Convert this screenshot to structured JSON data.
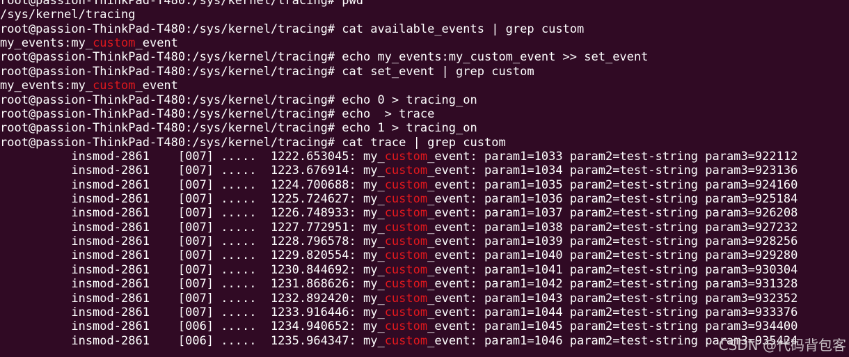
{
  "terminal": {
    "lines": [
      [
        {
          "t": "root@passion-ThinkPad-T480:/sys/kernel/tracing# pwd"
        }
      ],
      [
        {
          "t": "/sys/kernel/tracing"
        }
      ],
      [
        {
          "t": "root@passion-ThinkPad-T480:/sys/kernel/tracing# cat available_events | grep custom"
        }
      ],
      [
        {
          "t": "my_events:my_"
        },
        {
          "t": "custom",
          "h": true
        },
        {
          "t": "_event"
        }
      ],
      [
        {
          "t": "root@passion-ThinkPad-T480:/sys/kernel/tracing# echo my_events:my_custom_event >> set_event"
        }
      ],
      [
        {
          "t": "root@passion-ThinkPad-T480:/sys/kernel/tracing# cat set_event | grep custom"
        }
      ],
      [
        {
          "t": "my_events:my_"
        },
        {
          "t": "custom",
          "h": true
        },
        {
          "t": "_event"
        }
      ],
      [
        {
          "t": "root@passion-ThinkPad-T480:/sys/kernel/tracing# echo 0 > tracing_on"
        }
      ],
      [
        {
          "t": "root@passion-ThinkPad-T480:/sys/kernel/tracing# echo  > trace"
        }
      ],
      [
        {
          "t": "root@passion-ThinkPad-T480:/sys/kernel/tracing# echo 1 > tracing_on"
        }
      ],
      [
        {
          "t": "root@passion-ThinkPad-T480:/sys/kernel/tracing# cat trace | grep custom"
        }
      ],
      [
        {
          "t": "          insmod-2861    [007] .....  1222.653045: my_"
        },
        {
          "t": "custom",
          "h": true
        },
        {
          "t": "_event: param1=1033 param2=test-string param3=922112"
        }
      ],
      [
        {
          "t": "          insmod-2861    [007] .....  1223.676914: my_"
        },
        {
          "t": "custom",
          "h": true
        },
        {
          "t": "_event: param1=1034 param2=test-string param3=923136"
        }
      ],
      [
        {
          "t": "          insmod-2861    [007] .....  1224.700688: my_"
        },
        {
          "t": "custom",
          "h": true
        },
        {
          "t": "_event: param1=1035 param2=test-string param3=924160"
        }
      ],
      [
        {
          "t": "          insmod-2861    [007] .....  1225.724627: my_"
        },
        {
          "t": "custom",
          "h": true
        },
        {
          "t": "_event: param1=1036 param2=test-string param3=925184"
        }
      ],
      [
        {
          "t": "          insmod-2861    [007] .....  1226.748933: my_"
        },
        {
          "t": "custom",
          "h": true
        },
        {
          "t": "_event: param1=1037 param2=test-string param3=926208"
        }
      ],
      [
        {
          "t": "          insmod-2861    [007] .....  1227.772951: my_"
        },
        {
          "t": "custom",
          "h": true
        },
        {
          "t": "_event: param1=1038 param2=test-string param3=927232"
        }
      ],
      [
        {
          "t": "          insmod-2861    [007] .....  1228.796578: my_"
        },
        {
          "t": "custom",
          "h": true
        },
        {
          "t": "_event: param1=1039 param2=test-string param3=928256"
        }
      ],
      [
        {
          "t": "          insmod-2861    [007] .....  1229.820554: my_"
        },
        {
          "t": "custom",
          "h": true
        },
        {
          "t": "_event: param1=1040 param2=test-string param3=929280"
        }
      ],
      [
        {
          "t": "          insmod-2861    [007] .....  1230.844692: my_"
        },
        {
          "t": "custom",
          "h": true
        },
        {
          "t": "_event: param1=1041 param2=test-string param3=930304"
        }
      ],
      [
        {
          "t": "          insmod-2861    [007] .....  1231.868626: my_"
        },
        {
          "t": "custom",
          "h": true
        },
        {
          "t": "_event: param1=1042 param2=test-string param3=931328"
        }
      ],
      [
        {
          "t": "          insmod-2861    [007] .....  1232.892420: my_"
        },
        {
          "t": "custom",
          "h": true
        },
        {
          "t": "_event: param1=1043 param2=test-string param3=932352"
        }
      ],
      [
        {
          "t": "          insmod-2861    [007] .....  1233.916446: my_"
        },
        {
          "t": "custom",
          "h": true
        },
        {
          "t": "_event: param1=1044 param2=test-string param3=933376"
        }
      ],
      [
        {
          "t": "          insmod-2861    [006] .....  1234.940652: my_"
        },
        {
          "t": "custom",
          "h": true
        },
        {
          "t": "_event: param1=1045 param2=test-string param3=934400"
        }
      ],
      [
        {
          "t": "          insmod-2861    [006] .....  1235.964347: my_"
        },
        {
          "t": "custom",
          "h": true
        },
        {
          "t": "_event: param1=1046 param2=test-string param3=935424"
        }
      ]
    ]
  },
  "watermark": "CSDN @代码背包客",
  "colors": {
    "background": "#300a24",
    "text": "#ffffff",
    "grep_match": "#e2181d"
  }
}
